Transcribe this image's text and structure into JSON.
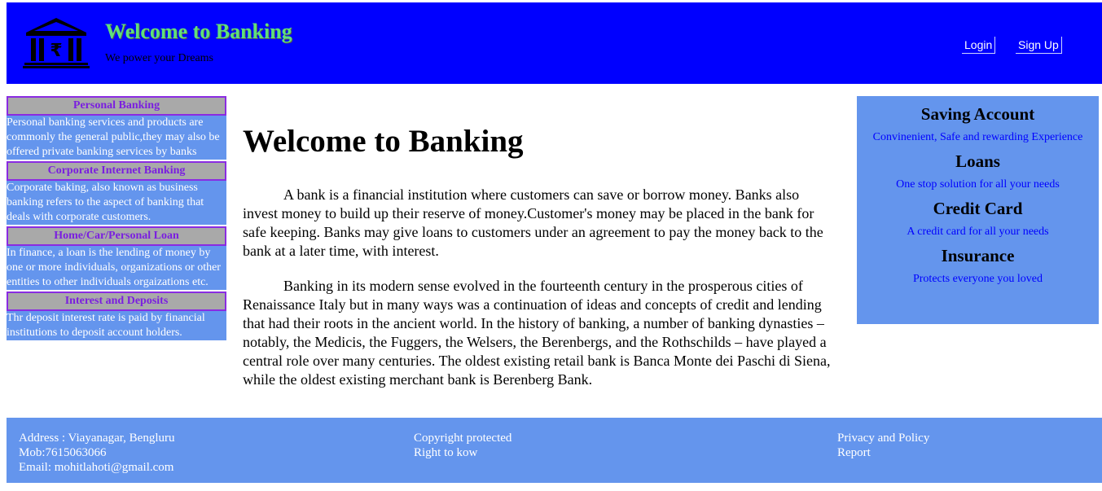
{
  "header": {
    "title": "Welcome to Banking",
    "tagline": "We power your Dreams",
    "logo_icon": "bank-building-rupee-icon",
    "nav": {
      "login": "Login",
      "signup": "Sign Up"
    },
    "colors": {
      "background": "#0000ff",
      "title": "#5fe07a"
    }
  },
  "sidebar": {
    "items": [
      {
        "title": "Personal Banking",
        "body": "Personal banking services and products are commonly the general public,they may also be offered private banking services by banks"
      },
      {
        "title": "Corporate Internet Banking",
        "body": "Corporate baking, also known as business banking refers to the aspect of banking that deals with corporate customers."
      },
      {
        "title": "Home/Car/Personal Loan",
        "body": "In finance, a loan is the lending of money by one or more individuals, organizations or other entities to other individuals orgaizations etc."
      },
      {
        "title": "Interest and Deposits",
        "body": "Thr deposit interest rate is paid by financial institutions to deposit account holders."
      }
    ]
  },
  "main": {
    "heading": "Welcome to Banking",
    "paragraphs": [
      "A bank is a financial institution where customers can save or borrow money. Banks also invest money to build up their reserve of money.Customer's money may be placed in the bank for safe keeping. Banks may give loans to customers under an agreement to pay the money back to the bank at a later time, with interest.",
      "Banking in its modern sense evolved in the fourteenth century in the prosperous cities of Renaissance Italy but in many ways was a continuation of ideas and concepts of credit and lending that had their roots in the ancient world. In the history of banking, a number of banking dynasties – notably, the Medicis, the Fuggers, the Welsers, the Berenbergs, and the Rothschilds – have played a central role over many centuries. The oldest existing retail bank is Banca Monte dei Paschi di Siena, while the oldest existing merchant bank is Berenberg Bank."
    ]
  },
  "services": [
    {
      "heading": "Saving Account",
      "desc": "Convinenient, Safe and rewarding Experience"
    },
    {
      "heading": "Loans",
      "desc": "One stop solution for all your needs"
    },
    {
      "heading": "Credit Card",
      "desc": "A credit card for all your needs"
    },
    {
      "heading": "Insurance",
      "desc": "Protects everyone you loved"
    }
  ],
  "footer": {
    "address": "Address : Viayanagar, Bengluru",
    "mobile": "Mob:7615063066",
    "email": "Email: mohitlahoti@gmail.com",
    "copyright": "Copyright protected",
    "right_to_know": "Right to kow",
    "privacy": "Privacy and Policy",
    "report": "Report",
    "background": "#6495ed"
  }
}
